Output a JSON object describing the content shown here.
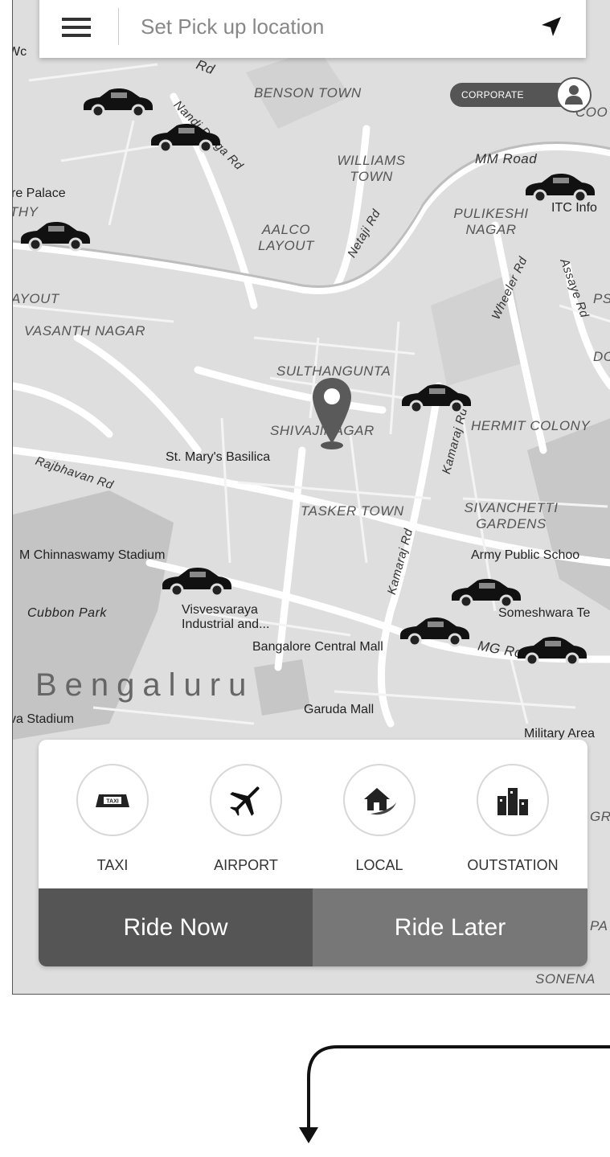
{
  "search": {
    "placeholder": "Set Pick up location"
  },
  "corporate": {
    "label": "CORPORATE"
  },
  "map": {
    "labels": {
      "benson_town": "BENSON TOWN",
      "williams_town": "WILLIAMS TOWN",
      "mm_road": "MM Road",
      "pulikeshi_nagar": "PULIKESHI NAGAR",
      "itc_info": "ITC Info",
      "palace": "re Palace",
      "thy": "THY",
      "aalco_layout": "AALCO LAYOUT",
      "nandi_durga_rd": "Nandi Durga Rd",
      "netaji_rd": "Netaji Rd",
      "wheeler_rd": "Wheeler Rd",
      "assaye_rd": "Assaye Rd",
      "ayout": "AYOUT",
      "vasanth_nagar": "VASANTH NAGAR",
      "sulthangunta": "SULTHANGUNTA",
      "shivaji_nagar": "SHIVAJINAGAR",
      "hermit_colony": "HERMIT COLONY",
      "st_marys": "St. Mary's Basilica",
      "rajbhavan_rd": "Rajbhavan Rd",
      "kamaraj_rd": "Kamaraj Rd",
      "tasker_town": "TASKER TOWN",
      "sivanchetti_gardens": "SIVANCHETTI GARDENS",
      "chinnaswamy": "M Chinnaswamy Stadium",
      "army_public": "Army Public Schoo",
      "cubbon_park": "Cubbon Park",
      "visvesvaraya": "Visvesvaraya Industrial and...",
      "someshwara": "Someshwara Te",
      "central_mall": "Bangalore Central Mall",
      "mg_road": "MG Road",
      "bengaluru": "Bengaluru",
      "va_stadium": "va Stadium",
      "garuda_mall": "Garuda Mall",
      "military_area": "Military Area",
      "coo": "COO",
      "wc": "Wc",
      "rd": "Rd",
      "ps": "PS",
      "dc": "DC",
      "gr": "GR",
      "pa": "PA",
      "sonena": "SONENA"
    }
  },
  "categories": [
    {
      "label": "TAXI",
      "icon": "taxi-icon"
    },
    {
      "label": "AIRPORT",
      "icon": "airplane-icon"
    },
    {
      "label": "LOCAL",
      "icon": "house-icon"
    },
    {
      "label": "OUTSTATION",
      "icon": "buildings-icon"
    }
  ],
  "actions": {
    "ride_now": "Ride Now",
    "ride_later": "Ride Later"
  },
  "colors": {
    "primary_dark": "#555555",
    "secondary": "#777777",
    "map_bg": "#dcdcdc"
  }
}
